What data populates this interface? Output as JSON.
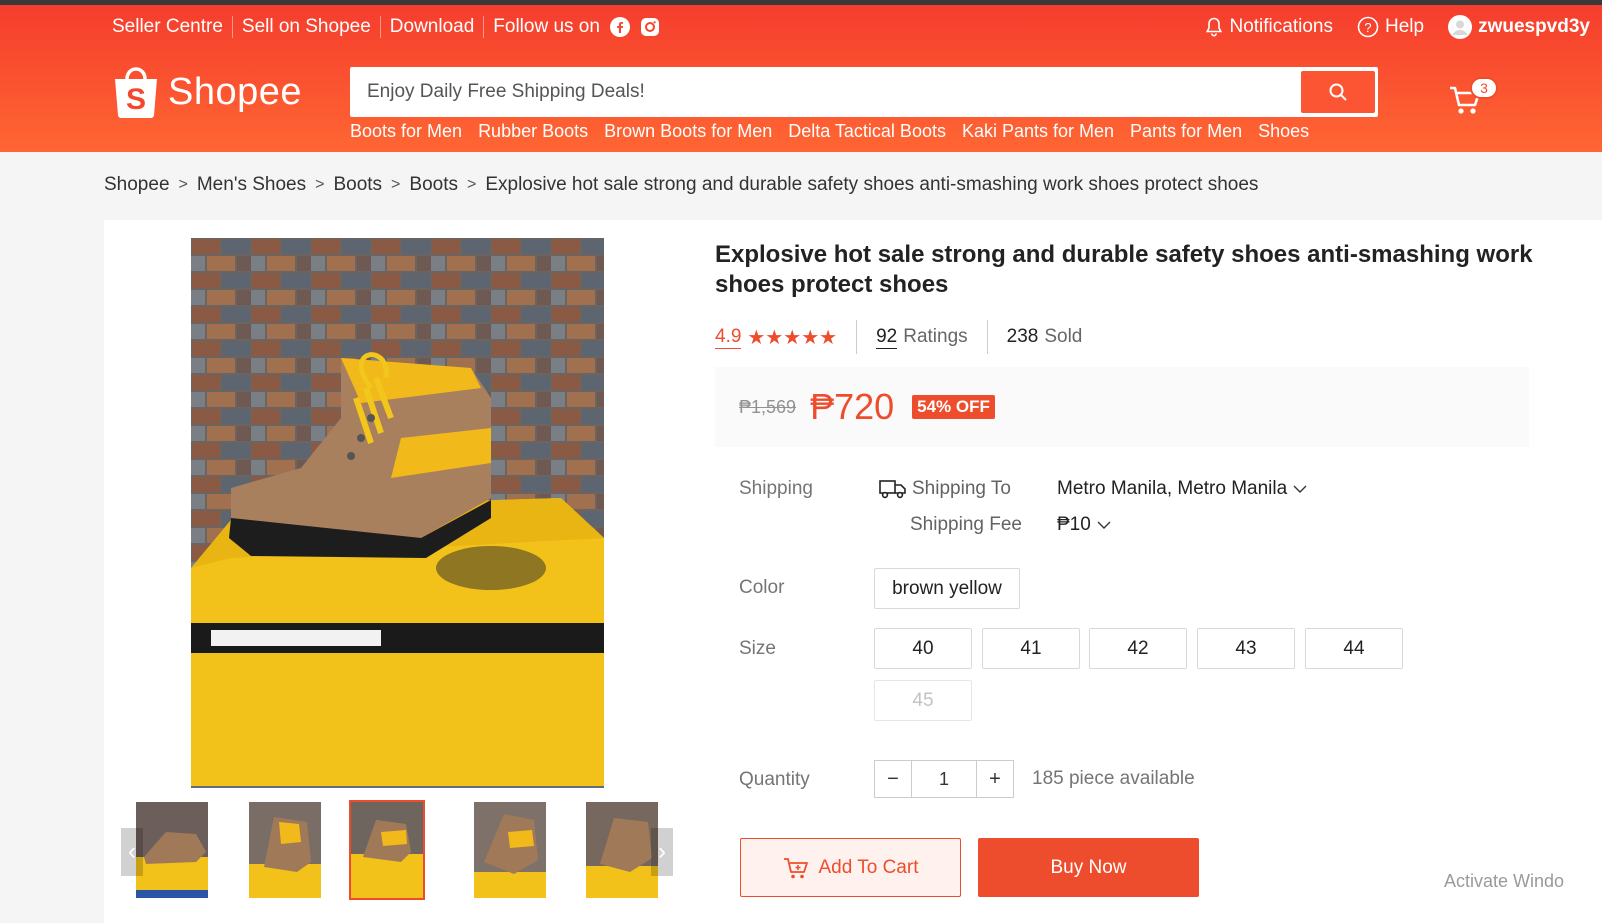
{
  "header": {
    "nav_left": [
      "Seller Centre",
      "Sell on Shopee",
      "Download"
    ],
    "follow_label": "Follow us on",
    "notifications": "Notifications",
    "help": "Help",
    "username": "zwuespvd3y",
    "logo_text": "Shopee",
    "search_placeholder": "Enjoy Daily Free Shipping Deals!",
    "suggestions": [
      "Boots for Men",
      "Rubber Boots",
      "Brown Boots for Men",
      "Delta Tactical Boots",
      "Kaki Pants for Men",
      "Pants for Men",
      "Shoes"
    ],
    "cart_count": "3",
    "brand_color": "#ee4d2d"
  },
  "breadcrumb": [
    "Shopee",
    "Men's Shoes",
    "Boots",
    "Boots",
    "Explosive hot sale strong and durable safety shoes anti-smashing work shoes protect shoes"
  ],
  "product": {
    "title": "Explosive hot sale strong and durable safety shoes anti-smashing work shoes protect shoes",
    "rating": "4.9",
    "stars": "★★★★★",
    "ratings_count": "92",
    "ratings_label": "Ratings",
    "sold_count": "238",
    "sold_label": "Sold",
    "old_price": "₱1,569",
    "price": "₱720",
    "discount": "54% OFF",
    "shipping": {
      "label": "Shipping",
      "to_label": "Shipping To",
      "to_value": "Metro Manila, Metro Manila",
      "fee_label": "Shipping Fee",
      "fee_value": "₱10"
    },
    "color": {
      "label": "Color",
      "options": [
        "brown yellow"
      ]
    },
    "size": {
      "label": "Size",
      "options": [
        "40",
        "41",
        "42",
        "43",
        "44",
        "45"
      ],
      "disabled": [
        "45"
      ]
    },
    "quantity": {
      "label": "Quantity",
      "value": "1",
      "minus": "−",
      "plus": "+",
      "available": "185 piece available"
    },
    "add_to_cart": "Add To Cart",
    "buy_now": "Buy Now"
  },
  "gallery": {
    "prev": "‹",
    "next": "›",
    "active_thumb": 3
  },
  "system": {
    "watermark": "Activate Windo"
  }
}
